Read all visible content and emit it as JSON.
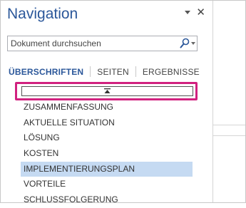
{
  "pane": {
    "title": "Navigation",
    "controls": [
      "caret-down-icon",
      "close-icon"
    ],
    "close_glyph": "✕"
  },
  "search": {
    "placeholder": "Dokument durchsuchen",
    "icon": "magnifier-icon",
    "options_icon": "caret-down-icon"
  },
  "tabs": [
    {
      "label": "ÜBERSCHRIFTEN",
      "active": true
    },
    {
      "label": "SEITEN",
      "active": false
    },
    {
      "label": "ERGEBNISSE",
      "active": false
    }
  ],
  "drop_target": {
    "icon": "move-up-arrow-icon",
    "highlight_color": "#d1217f"
  },
  "headings": [
    {
      "label": "ZUSAMMENFASSUNG",
      "selected": false
    },
    {
      "label": "AKTUELLE SITUATION",
      "selected": false
    },
    {
      "label": "LÖSUNG",
      "selected": false
    },
    {
      "label": "KOSTEN",
      "selected": false
    },
    {
      "label": "IMPLEMENTIERUNGSPLAN",
      "selected": true
    },
    {
      "label": "VORTEILE",
      "selected": false
    },
    {
      "label": "SCHLUSSFOLGERUNG",
      "selected": false
    }
  ],
  "colors": {
    "accent": "#2b579a",
    "selected_bg": "#c5daf2",
    "highlight": "#d1217f"
  }
}
